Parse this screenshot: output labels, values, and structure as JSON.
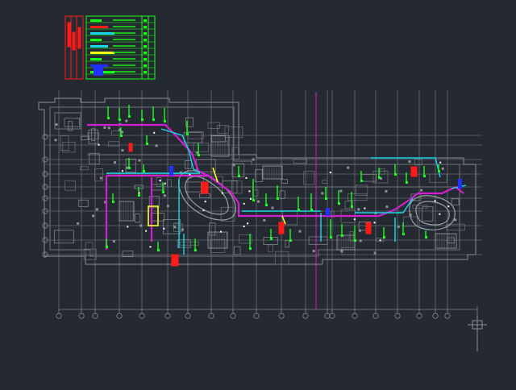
{
  "canvas": {
    "background": "#252a32"
  },
  "colors": {
    "structure": "#8a8f96",
    "structure_light": "#6e737a",
    "grid": "#7c8188",
    "magenta": "#d020d0",
    "cyan": "#19d8e8",
    "green": "#18ff18",
    "red": "#ff1a1a",
    "yellow": "#ffff20",
    "blue": "#2030ff",
    "white": "#ffffff"
  },
  "legend": {
    "title_block": {
      "color": "#ff1a1a"
    },
    "table": {
      "color": "#18ff18"
    }
  },
  "drawing": {
    "icons": [
      "view-cube-icon"
    ]
  }
}
